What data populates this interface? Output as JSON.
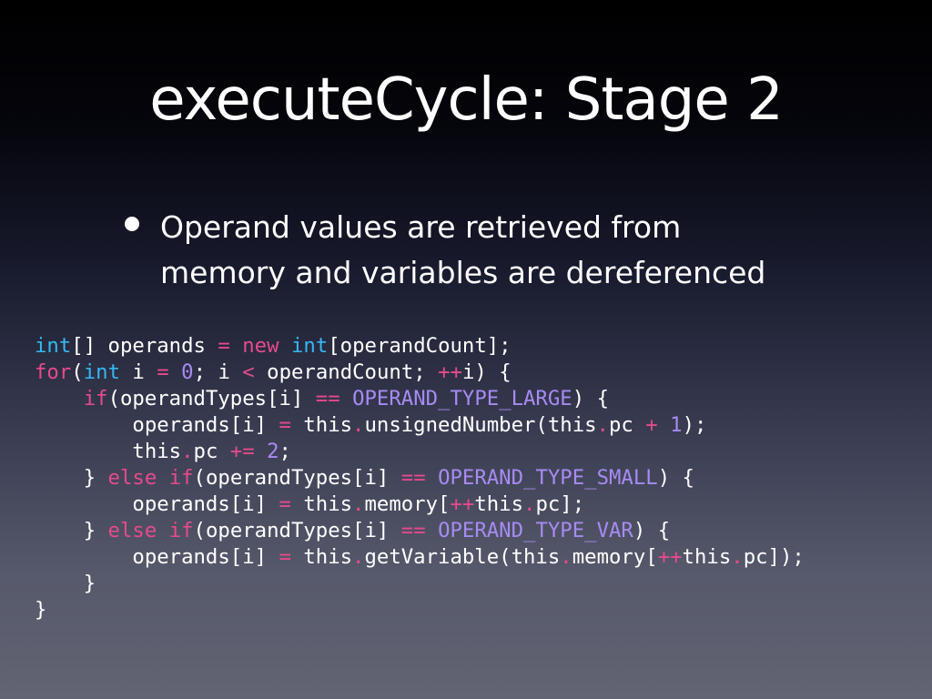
{
  "slide": {
    "title": "executeCycle: Stage 2",
    "bullets": [
      {
        "lines": [
          "Operand values are retrieved from",
          "memory and variables are dereferenced"
        ]
      }
    ]
  },
  "colors": {
    "type": "#36b7f2",
    "keyword": "#e64a8c",
    "operator": "#e64a8c",
    "number": "#a78bf2",
    "constant": "#a78bf2",
    "plain": "#ffffff"
  },
  "code": {
    "lines": [
      [
        {
          "t": "int",
          "c": "type"
        },
        {
          "t": "[] operands ",
          "c": "plain"
        },
        {
          "t": "=",
          "c": "op"
        },
        {
          "t": " ",
          "c": "plain"
        },
        {
          "t": "new",
          "c": "kw"
        },
        {
          "t": " ",
          "c": "plain"
        },
        {
          "t": "int",
          "c": "type"
        },
        {
          "t": "[operandCount];",
          "c": "plain"
        }
      ],
      [
        {
          "t": "for",
          "c": "kw"
        },
        {
          "t": "(",
          "c": "plain"
        },
        {
          "t": "int",
          "c": "type"
        },
        {
          "t": " i ",
          "c": "plain"
        },
        {
          "t": "=",
          "c": "op"
        },
        {
          "t": " ",
          "c": "plain"
        },
        {
          "t": "0",
          "c": "num"
        },
        {
          "t": "; i ",
          "c": "plain"
        },
        {
          "t": "<",
          "c": "op"
        },
        {
          "t": " operandCount; ",
          "c": "plain"
        },
        {
          "t": "++",
          "c": "op"
        },
        {
          "t": "i) {",
          "c": "plain"
        }
      ],
      [
        {
          "t": "    ",
          "c": "plain"
        },
        {
          "t": "if",
          "c": "kw"
        },
        {
          "t": "(operandTypes[i] ",
          "c": "plain"
        },
        {
          "t": "==",
          "c": "op"
        },
        {
          "t": " ",
          "c": "plain"
        },
        {
          "t": "OPERAND_TYPE_LARGE",
          "c": "const"
        },
        {
          "t": ") {",
          "c": "plain"
        }
      ],
      [
        {
          "t": "        operands[i] ",
          "c": "plain"
        },
        {
          "t": "=",
          "c": "op"
        },
        {
          "t": " this",
          "c": "plain"
        },
        {
          "t": ".",
          "c": "op"
        },
        {
          "t": "unsignedNumber(this",
          "c": "plain"
        },
        {
          "t": ".",
          "c": "op"
        },
        {
          "t": "pc ",
          "c": "plain"
        },
        {
          "t": "+",
          "c": "op"
        },
        {
          "t": " ",
          "c": "plain"
        },
        {
          "t": "1",
          "c": "num"
        },
        {
          "t": ");",
          "c": "plain"
        }
      ],
      [
        {
          "t": "        this",
          "c": "plain"
        },
        {
          "t": ".",
          "c": "op"
        },
        {
          "t": "pc ",
          "c": "plain"
        },
        {
          "t": "+=",
          "c": "op"
        },
        {
          "t": " ",
          "c": "plain"
        },
        {
          "t": "2",
          "c": "num"
        },
        {
          "t": ";",
          "c": "plain"
        }
      ],
      [
        {
          "t": "    } ",
          "c": "plain"
        },
        {
          "t": "else",
          "c": "kw"
        },
        {
          "t": " ",
          "c": "plain"
        },
        {
          "t": "if",
          "c": "kw"
        },
        {
          "t": "(operandTypes[i] ",
          "c": "plain"
        },
        {
          "t": "==",
          "c": "op"
        },
        {
          "t": " ",
          "c": "plain"
        },
        {
          "t": "OPERAND_TYPE_SMALL",
          "c": "const"
        },
        {
          "t": ") {",
          "c": "plain"
        }
      ],
      [
        {
          "t": "        operands[i] ",
          "c": "plain"
        },
        {
          "t": "=",
          "c": "op"
        },
        {
          "t": " this",
          "c": "plain"
        },
        {
          "t": ".",
          "c": "op"
        },
        {
          "t": "memory[",
          "c": "plain"
        },
        {
          "t": "++",
          "c": "op"
        },
        {
          "t": "this",
          "c": "plain"
        },
        {
          "t": ".",
          "c": "op"
        },
        {
          "t": "pc];",
          "c": "plain"
        }
      ],
      [
        {
          "t": "    } ",
          "c": "plain"
        },
        {
          "t": "else",
          "c": "kw"
        },
        {
          "t": " ",
          "c": "plain"
        },
        {
          "t": "if",
          "c": "kw"
        },
        {
          "t": "(operandTypes[i] ",
          "c": "plain"
        },
        {
          "t": "==",
          "c": "op"
        },
        {
          "t": " ",
          "c": "plain"
        },
        {
          "t": "OPERAND_TYPE_VAR",
          "c": "const"
        },
        {
          "t": ") {",
          "c": "plain"
        }
      ],
      [
        {
          "t": "        operands[i] ",
          "c": "plain"
        },
        {
          "t": "=",
          "c": "op"
        },
        {
          "t": " this",
          "c": "plain"
        },
        {
          "t": ".",
          "c": "op"
        },
        {
          "t": "getVariable(this",
          "c": "plain"
        },
        {
          "t": ".",
          "c": "op"
        },
        {
          "t": "memory[",
          "c": "plain"
        },
        {
          "t": "++",
          "c": "op"
        },
        {
          "t": "this",
          "c": "plain"
        },
        {
          "t": ".",
          "c": "op"
        },
        {
          "t": "pc]);",
          "c": "plain"
        }
      ],
      [
        {
          "t": "    }",
          "c": "plain"
        }
      ],
      [
        {
          "t": "}",
          "c": "plain"
        }
      ]
    ]
  }
}
